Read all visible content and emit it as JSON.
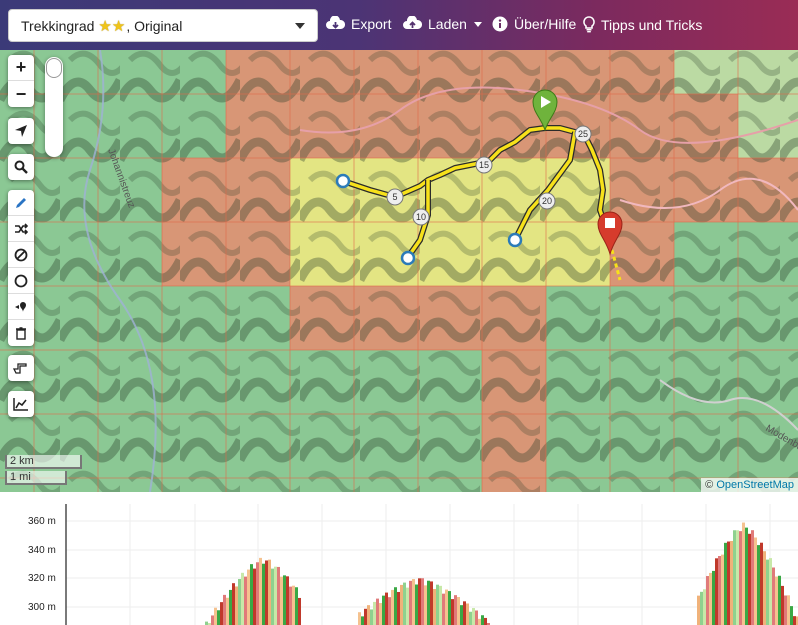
{
  "header": {
    "profile": {
      "name": "Trekkingrad",
      "stars": "★★",
      "suffix": ", Original"
    },
    "nav": [
      {
        "label": "Export",
        "icon": "cloud-download-icon"
      },
      {
        "label": "Laden",
        "icon": "cloud-upload-icon"
      },
      {
        "label": "Über/Hilfe",
        "icon": "info-icon"
      },
      {
        "label": "Tipps und Tricks",
        "icon": "lightbulb-icon"
      }
    ]
  },
  "map": {
    "controls": {
      "zoom_in": "+",
      "zoom_out": "−",
      "tools": [
        "locate-icon",
        "search-icon",
        "draw-icon",
        "shuffle-icon",
        "no-go-area-icon",
        "circle-icon",
        "poi-icon",
        "delete-icon",
        "hand-icon",
        "elevation-chart-icon"
      ]
    },
    "route_markers": [
      "5",
      "10",
      "15",
      "20",
      "25"
    ],
    "scale": {
      "metric": "2 km",
      "imperial": "1 mi"
    },
    "attribution": {
      "prefix": "©",
      "link": "OpenStreetMap"
    },
    "street_labels": [
      "Johannistreuz",
      "Modenbach"
    ]
  },
  "elevation": {
    "y_ticks": [
      "360 m",
      "340 m",
      "320 m",
      "300 m"
    ],
    "colors": {
      "low": "#3aa845",
      "mid": "#f0b27a",
      "high": "#c0392b"
    }
  }
}
